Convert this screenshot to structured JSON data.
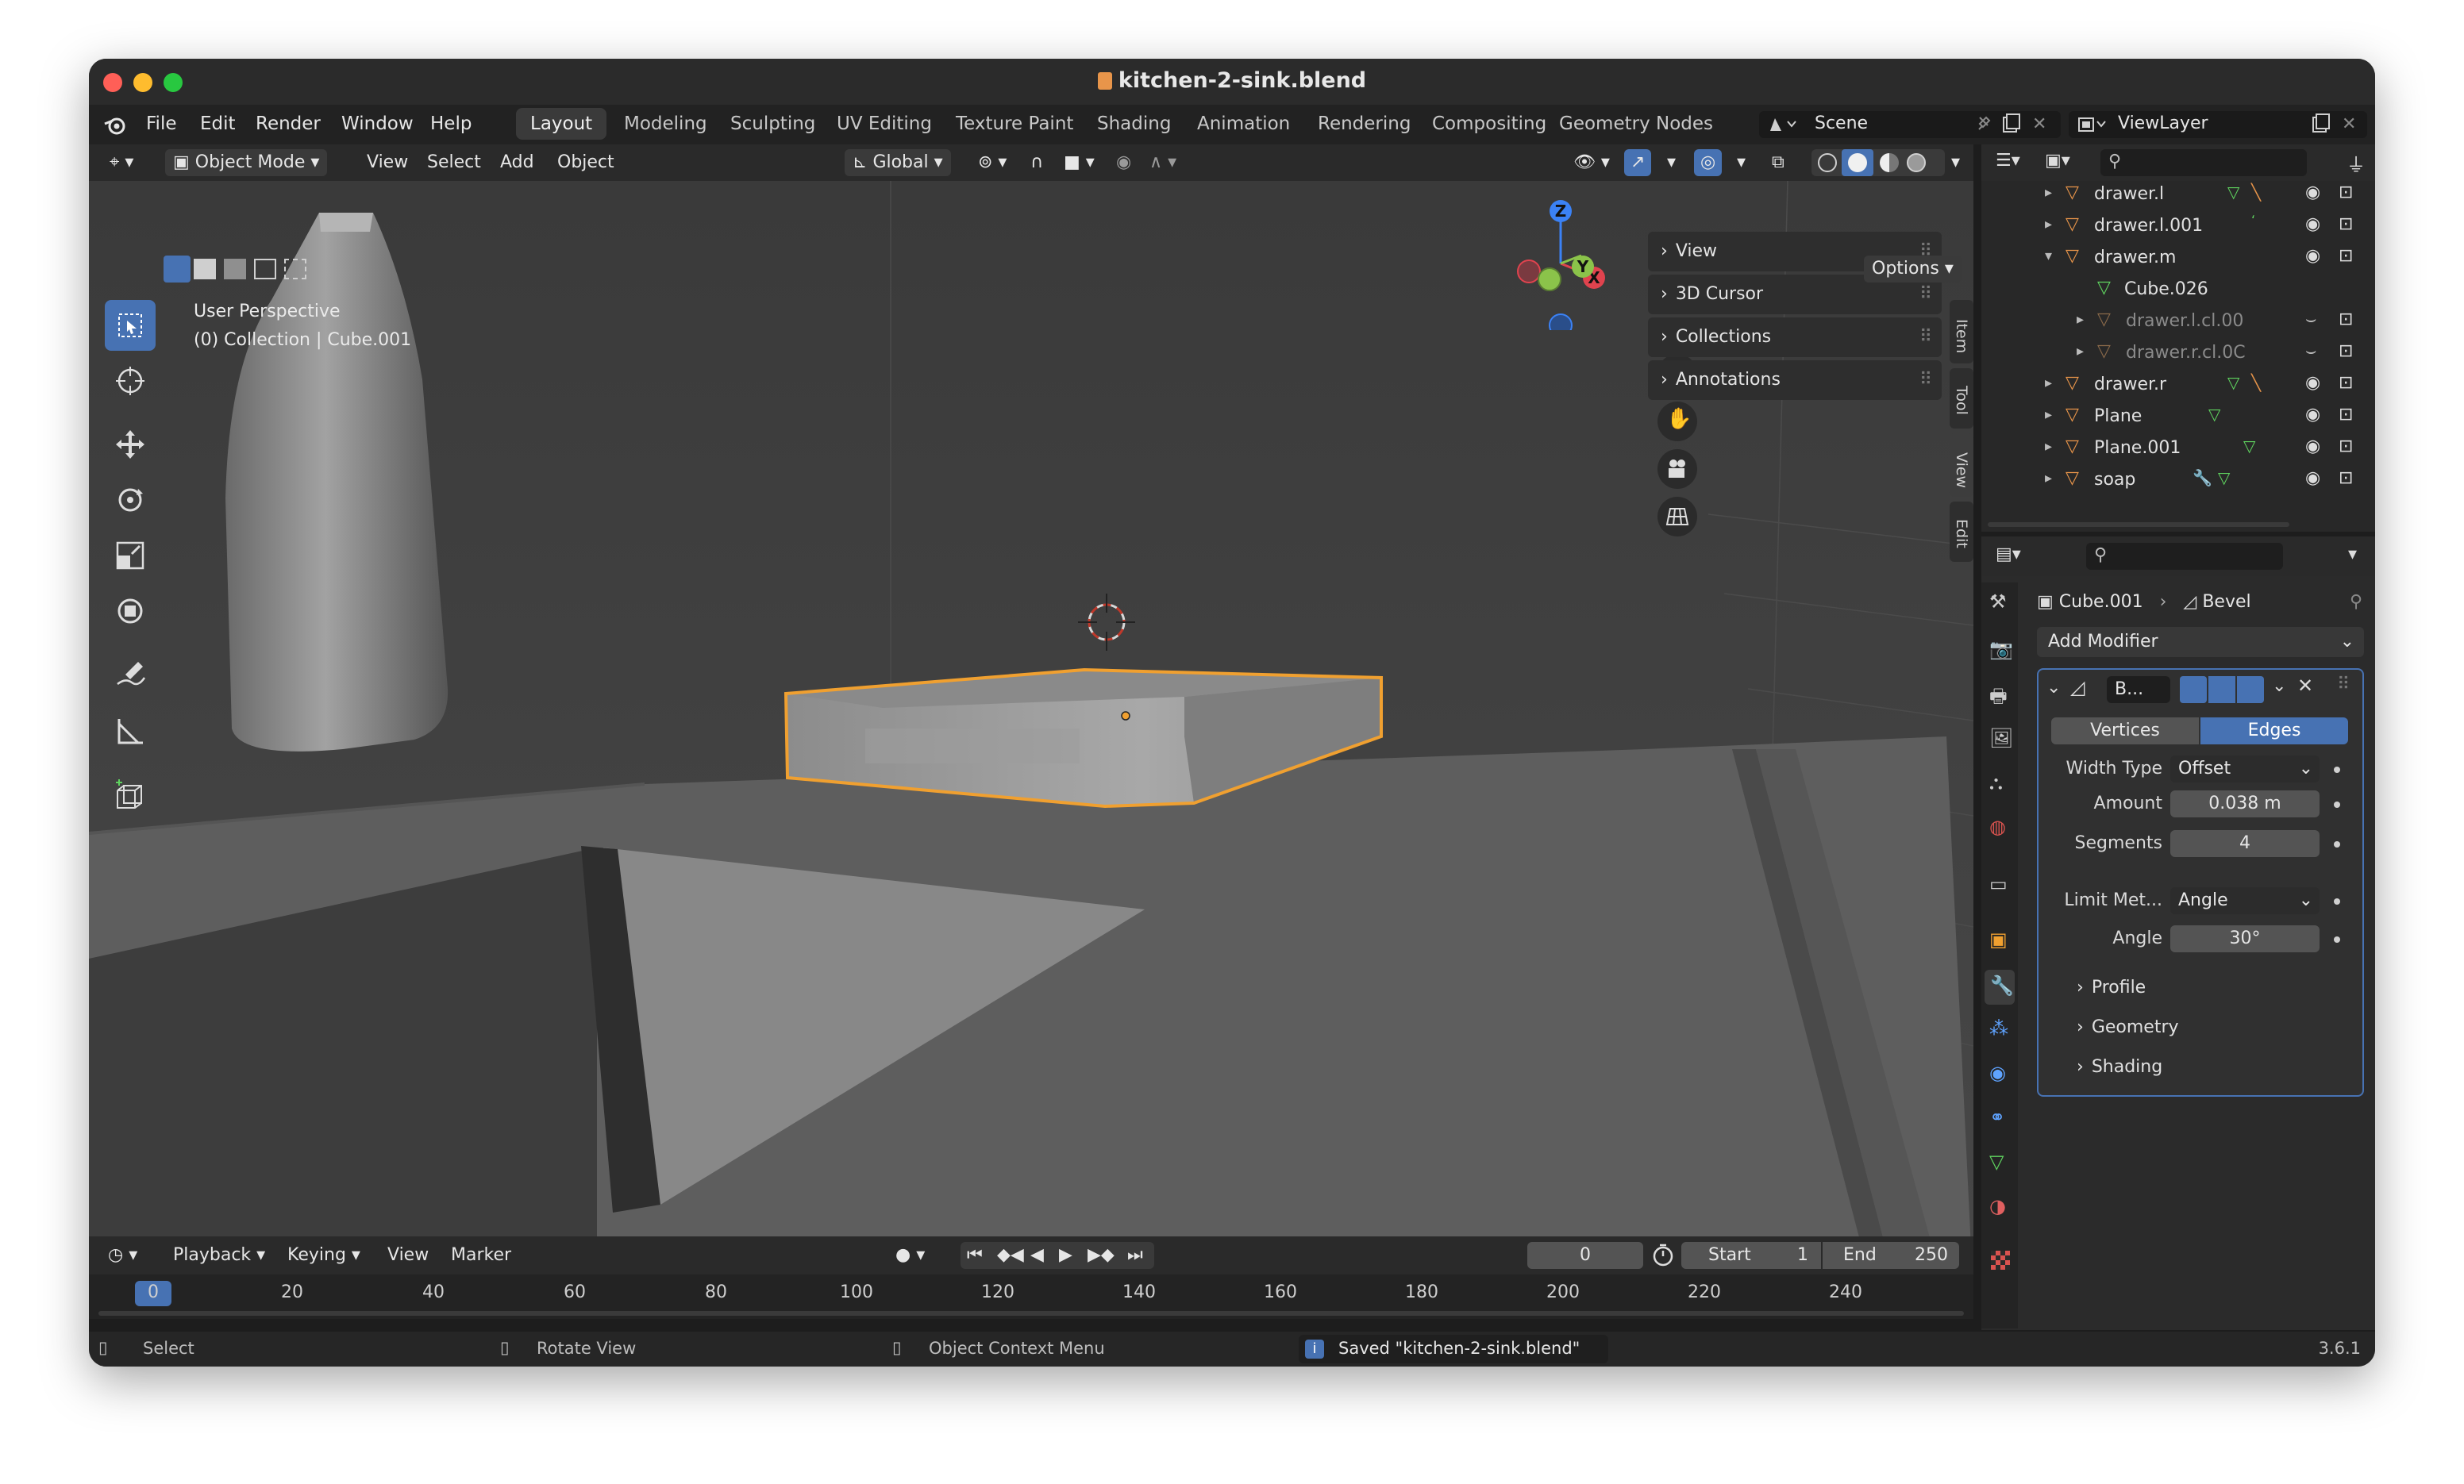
{
  "window": {
    "title": "kitchen-2-sink.blend"
  },
  "menu": [
    "File",
    "Edit",
    "Render",
    "Window",
    "Help"
  ],
  "workspaces": [
    "Layout",
    "Modeling",
    "Sculpting",
    "UV Editing",
    "Texture Paint",
    "Shading",
    "Animation",
    "Rendering",
    "Compositing",
    "Geometry Nodes"
  ],
  "active_workspace": "Layout",
  "scene": {
    "name": "Scene",
    "view_layer": "ViewLayer"
  },
  "viewport_header": {
    "mode": "Object Mode",
    "menus": [
      "View",
      "Select",
      "Add",
      "Object"
    ],
    "transform_orientation": "Global",
    "options_label": "Options"
  },
  "viewport": {
    "perspective_label": "User Perspective",
    "collection_label": "(0) Collection | Cube.001"
  },
  "gizmo": {
    "x": "X",
    "y": "Y",
    "z": "Z"
  },
  "sidebar": {
    "sections": [
      "View",
      "3D Cursor",
      "Collections",
      "Annotations"
    ],
    "tabs": [
      "Item",
      "Tool",
      "View",
      "Edit"
    ]
  },
  "outliner": {
    "rows": [
      {
        "name": "drawer.l",
        "expanded": false,
        "dim": false
      },
      {
        "name": "drawer.l.001",
        "expanded": false,
        "dim": false
      },
      {
        "name": "drawer.m",
        "expanded": true,
        "dim": false
      },
      {
        "name": "Cube.026",
        "child": true,
        "dim": false
      },
      {
        "name": "drawer.l.cl.00",
        "child": true,
        "dim": true
      },
      {
        "name": "drawer.r.cl.0C",
        "child": true,
        "dim": true
      },
      {
        "name": "drawer.r",
        "expanded": false,
        "dim": false
      },
      {
        "name": "Plane",
        "expanded": false,
        "dim": false
      },
      {
        "name": "Plane.001",
        "expanded": false,
        "dim": false
      },
      {
        "name": "soap",
        "expanded": false,
        "dim": false
      }
    ]
  },
  "properties": {
    "object": "Cube.001",
    "modifier_crumb": "Bevel",
    "add_modifier": "Add Modifier",
    "modifier_name": "B...",
    "affect": {
      "vertices": "Vertices",
      "edges": "Edges",
      "active": "Edges"
    },
    "width_type": {
      "label": "Width Type",
      "value": "Offset"
    },
    "amount": {
      "label": "Amount",
      "value": "0.038 m"
    },
    "segments": {
      "label": "Segments",
      "value": "4"
    },
    "limit_method": {
      "label": "Limit Met...",
      "value": "Angle"
    },
    "angle": {
      "label": "Angle",
      "value": "30°"
    },
    "subpanels": [
      "Profile",
      "Geometry",
      "Shading"
    ]
  },
  "timeline": {
    "menus": [
      "Playback",
      "Keying",
      "View",
      "Marker"
    ],
    "current_frame": "0",
    "start_label": "Start",
    "start": "1",
    "end_label": "End",
    "end": "250",
    "ruler": [
      "0",
      "20",
      "40",
      "60",
      "80",
      "100",
      "120",
      "140",
      "160",
      "180",
      "200",
      "220",
      "240"
    ]
  },
  "status": {
    "select": "Select",
    "rotate": "Rotate View",
    "context": "Object Context Menu",
    "message": "Saved \"kitchen-2-sink.blend\"",
    "version": "3.6.1"
  },
  "colors": {
    "accent": "#4772b3",
    "selection_outline": "#f0a030",
    "mesh_orange": "#e8954a"
  }
}
